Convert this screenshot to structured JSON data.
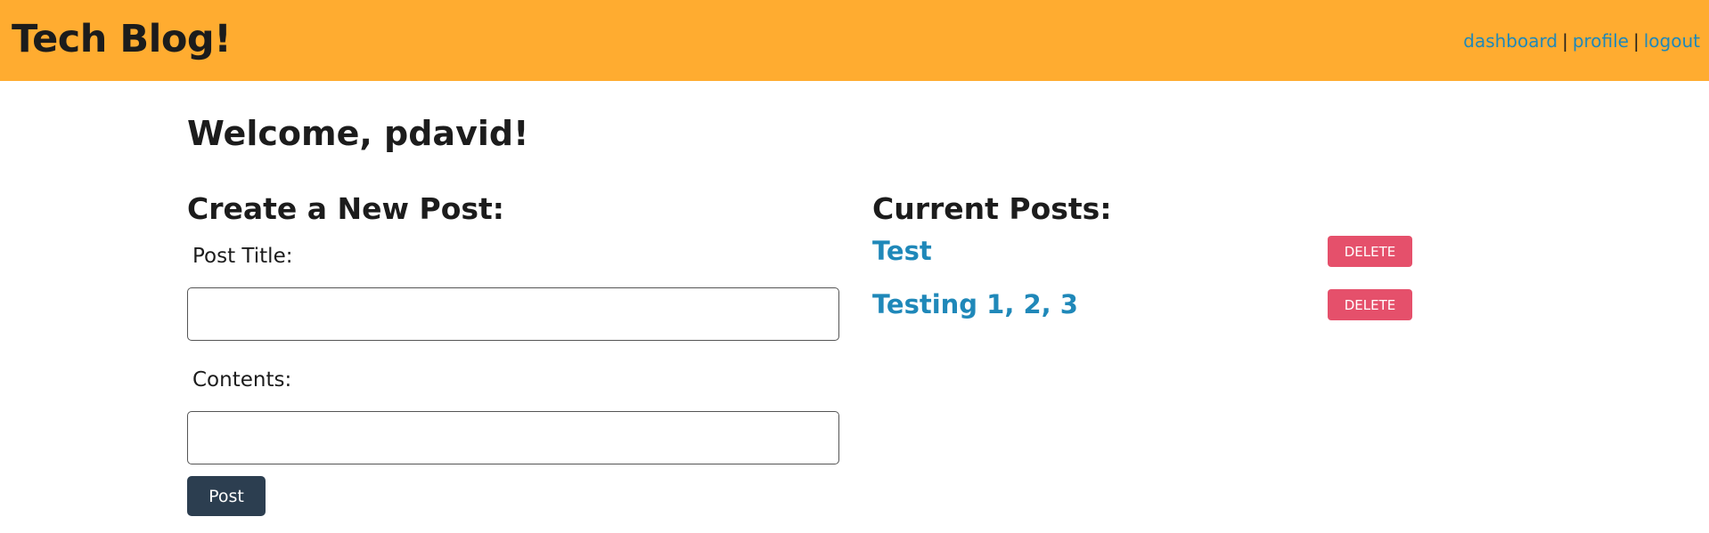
{
  "header": {
    "title": "Tech Blog!",
    "nav": {
      "dashboard": "dashboard",
      "profile": "profile",
      "logout": "logout",
      "separator": "|"
    }
  },
  "welcome": "Welcome, pdavid!",
  "create": {
    "heading": "Create a New Post:",
    "title_label": "Post Title:",
    "title_value": "",
    "contents_label": "Contents:",
    "contents_value": "",
    "submit_label": "Post"
  },
  "posts": {
    "heading": "Current Posts:",
    "items": [
      {
        "title": "Test",
        "delete_label": "DELETE"
      },
      {
        "title": "Testing 1, 2, 3",
        "delete_label": "DELETE"
      }
    ]
  },
  "colors": {
    "header_bg": "#ffac30",
    "link": "#1f88b9",
    "delete": "#e5506b",
    "post_button": "#2c3e50"
  }
}
